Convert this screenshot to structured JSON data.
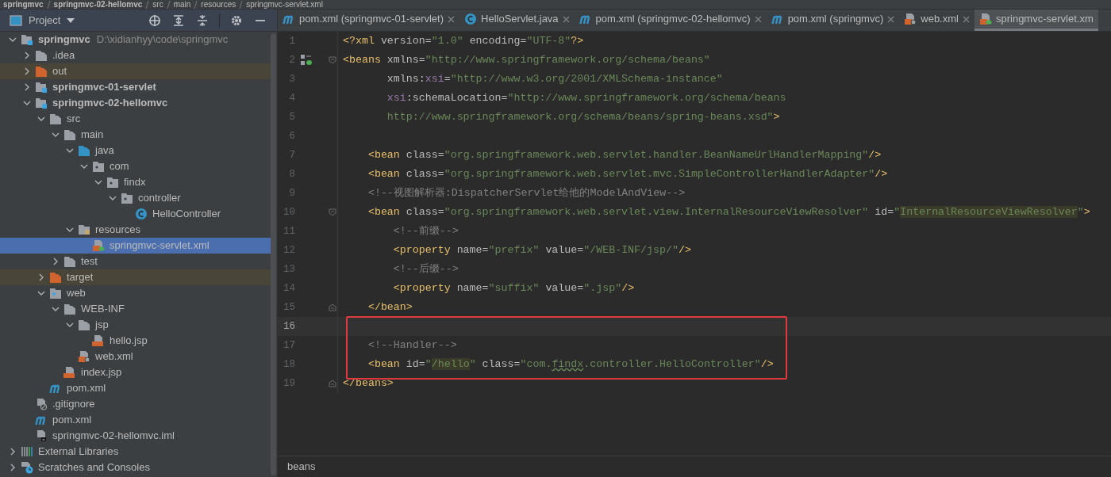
{
  "breadcrumb": [
    {
      "kind": "module",
      "label": "springmvc"
    },
    {
      "kind": "module",
      "label": "springmvc-02-hellomvc"
    },
    {
      "kind": "folder",
      "label": "src"
    },
    {
      "kind": "folder",
      "label": "main"
    },
    {
      "kind": "folder",
      "label": "resources"
    },
    {
      "kind": "xml-spring",
      "label": "springmvc-servlet.xml"
    }
  ],
  "project_panel": {
    "title": "Project",
    "tree": [
      {
        "kind": "module",
        "label": "springmvc",
        "hint": "D:\\xidianhyy\\code\\springmvc",
        "selected": false,
        "expanded": true,
        "children": [
          {
            "kind": "folder",
            "label": ".idea",
            "selected": false,
            "expanded": false
          },
          {
            "kind": "excluded",
            "label": "out",
            "selected": false,
            "expanded": false
          },
          {
            "kind": "module",
            "label": "springmvc-01-servlet",
            "selected": false,
            "expanded": false
          },
          {
            "kind": "module",
            "label": "springmvc-02-hellomvc",
            "selected": false,
            "expanded": true,
            "children": [
              {
                "kind": "folder",
                "label": "src",
                "selected": false,
                "expanded": true,
                "children": [
                  {
                    "kind": "folder",
                    "label": "main",
                    "selected": false,
                    "expanded": true,
                    "children": [
                      {
                        "kind": "source",
                        "label": "java",
                        "selected": false,
                        "expanded": true,
                        "children": [
                          {
                            "kind": "package",
                            "label": "com",
                            "selected": false,
                            "expanded": true,
                            "children": [
                              {
                                "kind": "package",
                                "label": "findx",
                                "selected": false,
                                "expanded": true,
                                "children": [
                                  {
                                    "kind": "package",
                                    "label": "controller",
                                    "selected": false,
                                    "expanded": true,
                                    "children": [
                                      {
                                        "kind": "class",
                                        "label": "HelloController",
                                        "selected": false
                                      }
                                    ]
                                  }
                                ]
                              }
                            ]
                          }
                        ]
                      },
                      {
                        "kind": "resources",
                        "label": "resources",
                        "selected": false,
                        "expanded": true,
                        "children": [
                          {
                            "kind": "xml-spring",
                            "label": "springmvc-servlet.xml",
                            "selected": true
                          }
                        ]
                      }
                    ]
                  },
                  {
                    "kind": "folder",
                    "label": "test",
                    "selected": false,
                    "expanded": false
                  }
                ]
              },
              {
                "kind": "excluded",
                "label": "target",
                "selected": false,
                "expanded": false
              },
              {
                "kind": "web",
                "label": "web",
                "selected": false,
                "expanded": true,
                "children": [
                  {
                    "kind": "folder",
                    "label": "WEB-INF",
                    "selected": false,
                    "expanded": true,
                    "children": [
                      {
                        "kind": "folder",
                        "label": "jsp",
                        "selected": false,
                        "expanded": true,
                        "children": [
                          {
                            "kind": "jsp",
                            "label": "hello.jsp",
                            "selected": false
                          }
                        ]
                      },
                      {
                        "kind": "web-xml",
                        "label": "web.xml",
                        "selected": false
                      }
                    ]
                  },
                  {
                    "kind": "jsp",
                    "label": "index.jsp",
                    "selected": false
                  }
                ]
              },
              {
                "kind": "maven",
                "label": "pom.xml",
                "selected": false
              }
            ]
          },
          {
            "kind": "gitignore",
            "label": ".gitignore",
            "selected": false
          },
          {
            "kind": "maven",
            "label": "pom.xml",
            "selected": false
          },
          {
            "kind": "iml",
            "label": "springmvc-02-hellomvc.iml",
            "selected": false
          }
        ]
      },
      {
        "kind": "libraries",
        "label": "External Libraries",
        "selected": false,
        "expanded": false
      },
      {
        "kind": "scratches",
        "label": "Scratches and Consoles",
        "selected": false,
        "expanded": false
      }
    ]
  },
  "tabs": [
    {
      "kind": "maven",
      "label": "pom.xml (springmvc-01-servlet)",
      "selected": false,
      "close_button": true
    },
    {
      "kind": "class",
      "label": "HelloServlet.java",
      "selected": false,
      "close_button": true
    },
    {
      "kind": "maven",
      "label": "pom.xml (springmvc-02-hellomvc)",
      "selected": false,
      "close_button": true
    },
    {
      "kind": "maven",
      "label": "pom.xml (springmvc)",
      "selected": false,
      "close_button": true
    },
    {
      "kind": "web-xml",
      "label": "web.xml",
      "selected": false,
      "close_button": true
    },
    {
      "kind": "xml-spring",
      "label": "springmvc-servlet.xm",
      "selected": true,
      "close_button": false
    }
  ],
  "editor": {
    "lines": [
      {
        "number": "1",
        "current": false,
        "tokens": [
          {
            "kind": "tag",
            "text": "<?xml "
          },
          {
            "kind": "attr",
            "text": "version"
          },
          {
            "kind": "punct",
            "text": "="
          },
          {
            "kind": "value",
            "text": "\"1.0\" "
          },
          {
            "kind": "attr",
            "text": "encoding"
          },
          {
            "kind": "punct",
            "text": "="
          },
          {
            "kind": "value",
            "text": "\"UTF-8\""
          },
          {
            "kind": "tag",
            "text": "?>"
          }
        ]
      },
      {
        "number": "2",
        "current": false,
        "bean_icon": true,
        "fold_start": true,
        "tokens": [
          {
            "kind": "tag",
            "text": "<beans "
          },
          {
            "kind": "attr",
            "text": "xmlns"
          },
          {
            "kind": "punct",
            "text": "="
          },
          {
            "kind": "value",
            "text": "\"http://www.springframework.org/schema/beans\""
          }
        ]
      },
      {
        "number": "3",
        "current": false,
        "tokens": [
          {
            "kind": "attr",
            "text": "       xmlns:"
          },
          {
            "kind": "ns",
            "text": "xsi"
          },
          {
            "kind": "punct",
            "text": "="
          },
          {
            "kind": "value",
            "text": "\"http://www.w3.org/2001/XMLSchema-instance\""
          }
        ]
      },
      {
        "number": "4",
        "current": false,
        "tokens": [
          {
            "kind": "ns",
            "text": "       xsi"
          },
          {
            "kind": "attr",
            "text": ":schemaLocation"
          },
          {
            "kind": "punct",
            "text": "="
          },
          {
            "kind": "value",
            "text": "\"http://www.springframework.org/schema/beans"
          }
        ]
      },
      {
        "number": "5",
        "current": false,
        "tokens": [
          {
            "kind": "value",
            "text": "       http://www.springframework.org/schema/beans/spring-beans.xsd\""
          },
          {
            "kind": "tag",
            "text": ">"
          }
        ]
      },
      {
        "number": "6",
        "current": false
      },
      {
        "number": "7",
        "current": false,
        "tokens": [
          {
            "kind": "tag",
            "text": "    <bean "
          },
          {
            "kind": "attr",
            "text": "class"
          },
          {
            "kind": "punct",
            "text": "="
          },
          {
            "kind": "value",
            "text": "\"org.springframework.web.servlet.handler.BeanNameUrlHandlerMapping\""
          },
          {
            "kind": "tag",
            "text": "/>"
          }
        ]
      },
      {
        "number": "8",
        "current": false,
        "tokens": [
          {
            "kind": "tag",
            "text": "    <bean "
          },
          {
            "kind": "attr",
            "text": "class"
          },
          {
            "kind": "punct",
            "text": "="
          },
          {
            "kind": "value",
            "text": "\"org.springframework.web.servlet.mvc.SimpleControllerHandlerAdapter\""
          },
          {
            "kind": "tag",
            "text": "/>"
          }
        ]
      },
      {
        "number": "9",
        "current": false,
        "tokens": [
          {
            "kind": "comment",
            "text": "    <!--视图解析器:DispatcherServlet给他的ModelAndView-->"
          }
        ]
      },
      {
        "number": "10",
        "current": false,
        "fold_start": true,
        "tokens": [
          {
            "kind": "tag",
            "text": "    <bean "
          },
          {
            "kind": "attr",
            "text": "class"
          },
          {
            "kind": "punct",
            "text": "="
          },
          {
            "kind": "value",
            "text": "\"org.springframework.web.servlet.view.InternalResourceViewResolver\" "
          },
          {
            "kind": "attr",
            "text": "id"
          },
          {
            "kind": "punct",
            "text": "="
          },
          {
            "kind": "value",
            "text": "\""
          },
          {
            "kind": "value",
            "text": "InternalResourceViewResolver",
            "highlight": true
          },
          {
            "kind": "value",
            "text": "\""
          },
          {
            "kind": "tag",
            "text": ">"
          }
        ]
      },
      {
        "number": "11",
        "current": false,
        "tokens": [
          {
            "kind": "comment",
            "text": "        <!--前缀-->"
          }
        ]
      },
      {
        "number": "12",
        "current": false,
        "tokens": [
          {
            "kind": "tag",
            "text": "        <property "
          },
          {
            "kind": "attr",
            "text": "name"
          },
          {
            "kind": "punct",
            "text": "="
          },
          {
            "kind": "value",
            "text": "\"prefix\" "
          },
          {
            "kind": "attr",
            "text": "value"
          },
          {
            "kind": "punct",
            "text": "="
          },
          {
            "kind": "value",
            "text": "\"/WEB-INF/jsp/\""
          },
          {
            "kind": "tag",
            "text": "/>"
          }
        ]
      },
      {
        "number": "13",
        "current": false,
        "tokens": [
          {
            "kind": "comment",
            "text": "        <!--后缀-->"
          }
        ]
      },
      {
        "number": "14",
        "current": false,
        "tokens": [
          {
            "kind": "tag",
            "text": "        <property "
          },
          {
            "kind": "attr",
            "text": "name"
          },
          {
            "kind": "punct",
            "text": "="
          },
          {
            "kind": "value",
            "text": "\"suffix\" "
          },
          {
            "kind": "attr",
            "text": "value"
          },
          {
            "kind": "punct",
            "text": "="
          },
          {
            "kind": "value",
            "text": "\".jsp\""
          },
          {
            "kind": "tag",
            "text": "/>"
          }
        ]
      },
      {
        "number": "15",
        "current": false,
        "fold_end": true,
        "tokens": [
          {
            "kind": "tag",
            "text": "    </bean>"
          }
        ]
      },
      {
        "number": "16",
        "current": true
      },
      {
        "number": "17",
        "current": false,
        "tokens": [
          {
            "kind": "comment",
            "text": "    <!--Handler-->"
          }
        ]
      },
      {
        "number": "18",
        "current": false,
        "tokens": [
          {
            "kind": "tag",
            "text": "    <bean "
          },
          {
            "kind": "attr",
            "text": "id"
          },
          {
            "kind": "punct",
            "text": "="
          },
          {
            "kind": "value",
            "text": "\""
          },
          {
            "kind": "value",
            "text": "/hello",
            "highlight": true
          },
          {
            "kind": "value",
            "text": "\" "
          },
          {
            "kind": "attr",
            "text": "class"
          },
          {
            "kind": "punct",
            "text": "="
          },
          {
            "kind": "value",
            "text": "\"com."
          },
          {
            "kind": "value",
            "text": "findx",
            "typo": true
          },
          {
            "kind": "value",
            "text": ".controller.HelloController\""
          },
          {
            "kind": "tag",
            "text": "/>"
          }
        ]
      },
      {
        "number": "19",
        "current": false,
        "fold_end": true,
        "tokens": [
          {
            "kind": "tag",
            "text": "</beans>"
          }
        ]
      }
    ],
    "status": "beans"
  }
}
